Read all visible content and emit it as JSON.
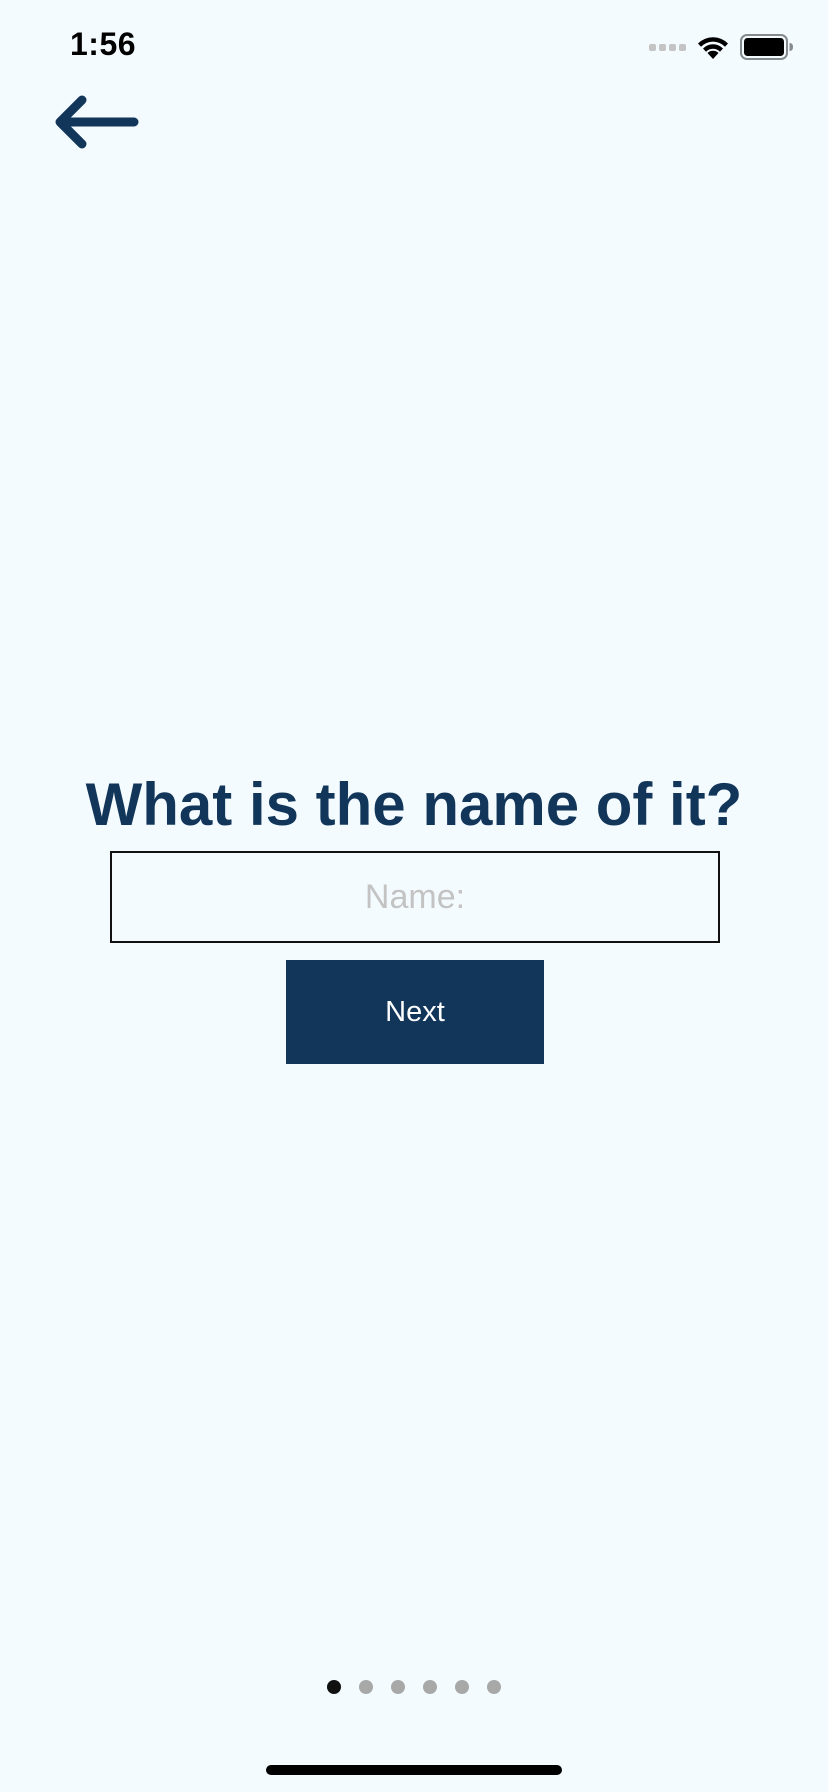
{
  "status_bar": {
    "time": "1:56",
    "icons": [
      "signal-dots-icon",
      "wifi-icon",
      "battery-icon"
    ]
  },
  "navigation": {
    "back_icon": "left-arrow-icon"
  },
  "form": {
    "question": "What is the name of it?",
    "name_field": {
      "value": "",
      "placeholder": "Name:"
    },
    "next_label": "Next"
  },
  "pager": {
    "total_pages": 6,
    "current_page": 1
  },
  "colors": {
    "background": "#f4fbff",
    "primary": "#12365a",
    "button_text": "#ffffff",
    "placeholder": "#c3c3c3",
    "dot_active": "#111111",
    "dot_inactive": "#a8a8a8"
  }
}
